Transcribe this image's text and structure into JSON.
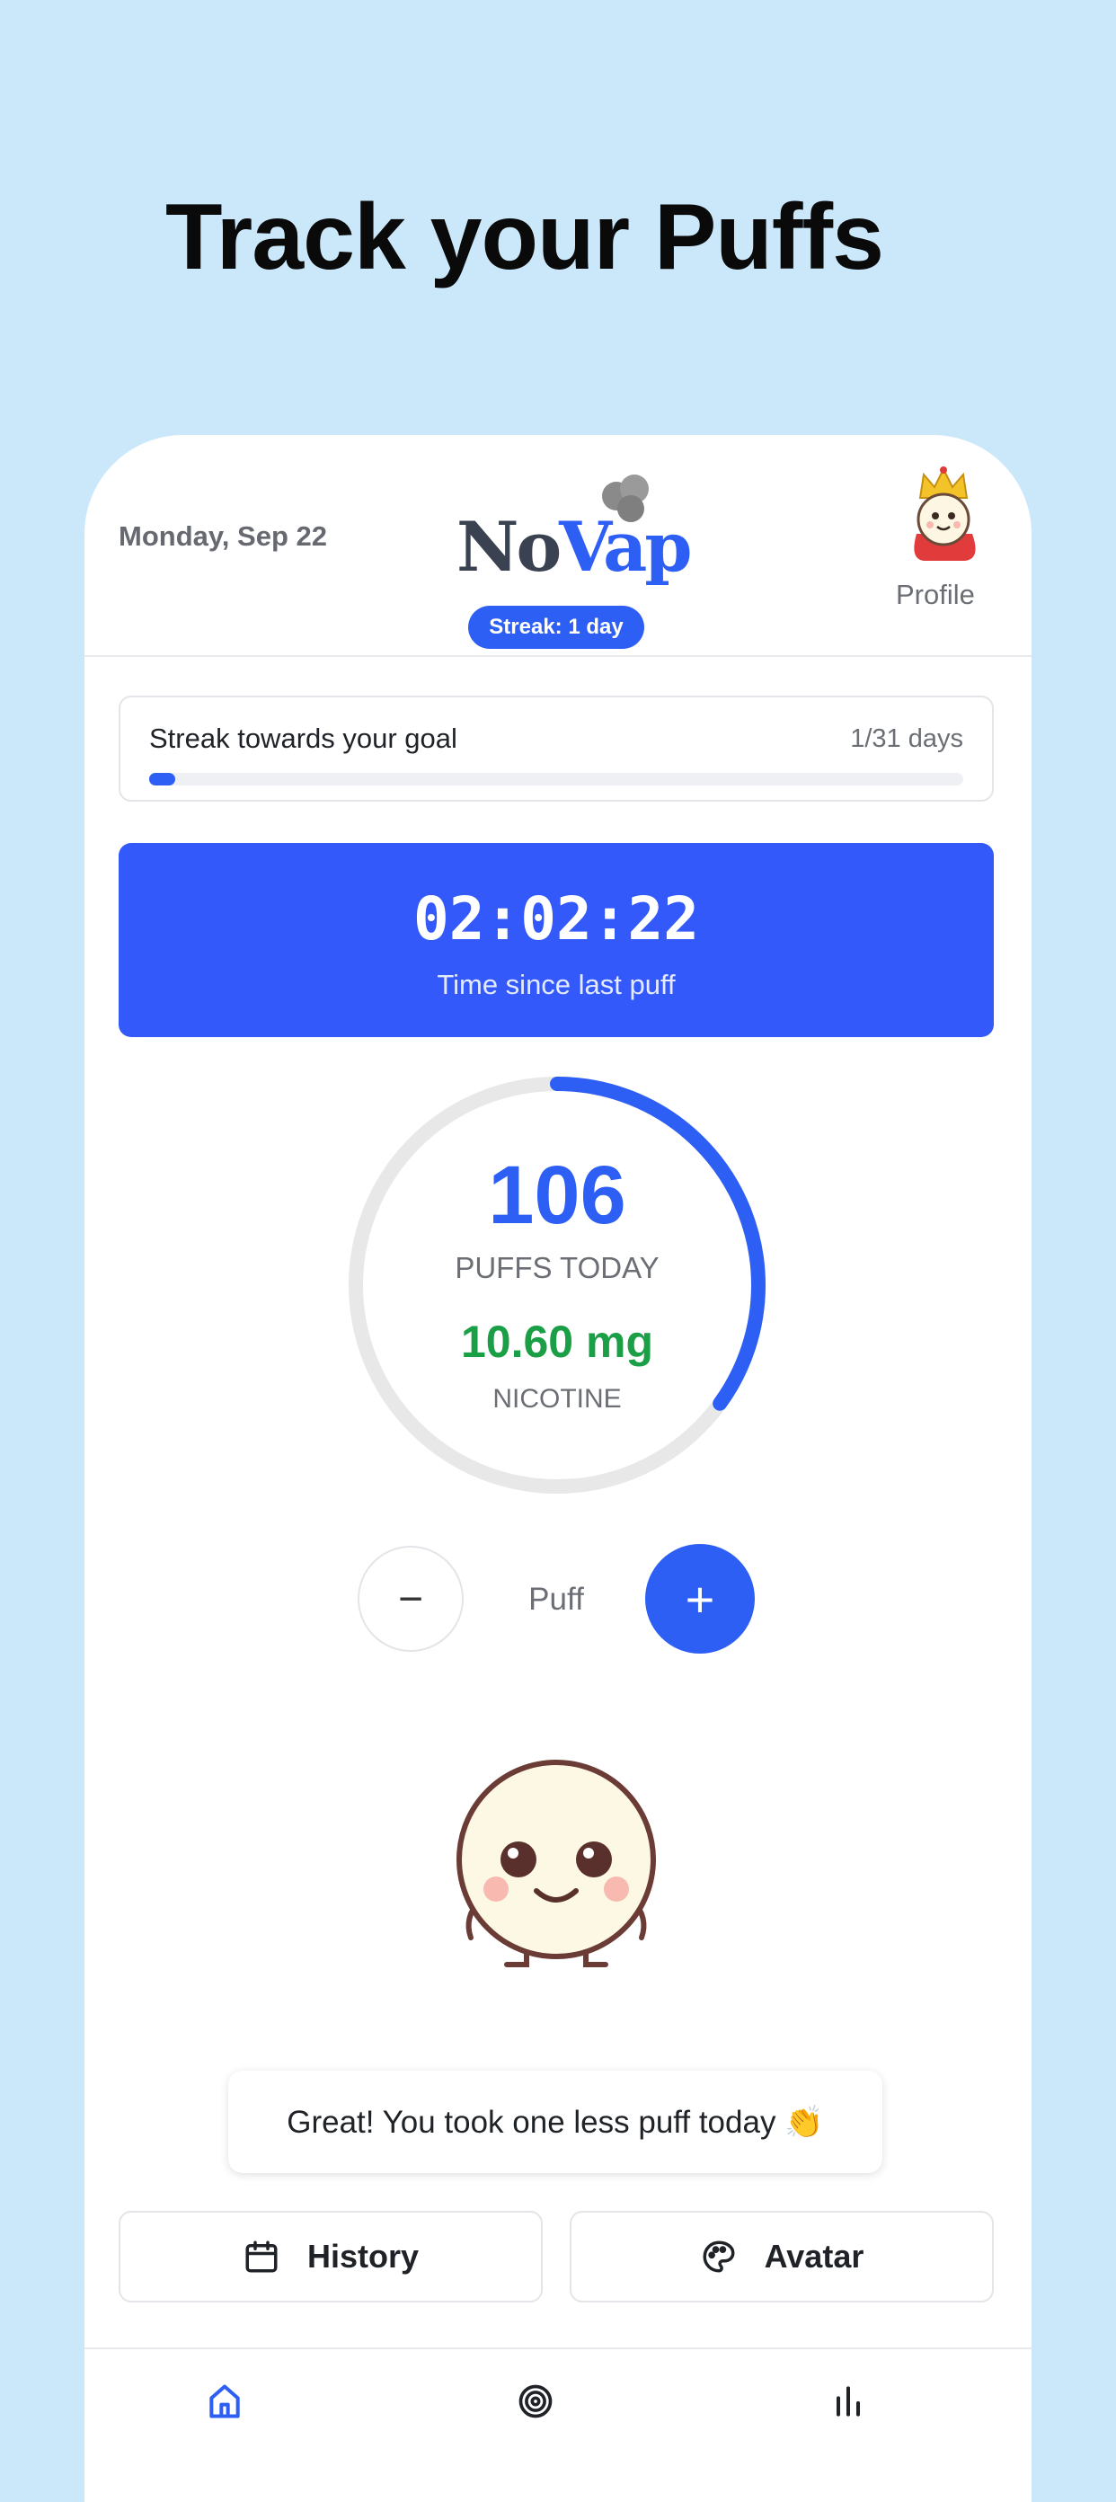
{
  "headline": "Track your Puffs",
  "header": {
    "date": "Monday, Sep 22",
    "logo_no": "No",
    "logo_vap": "Vap",
    "streak_badge": "Streak: 1 day",
    "profile_label": "Profile"
  },
  "goal": {
    "title": "Streak towards your goal",
    "days": "1/31 days",
    "progress_fraction": 0.032
  },
  "timer": {
    "value": "02:02:22",
    "label": "Time since last puff"
  },
  "stats": {
    "puffs_count": "106",
    "puffs_label": "PUFFS TODAY",
    "nicotine_value": "10.60 mg",
    "nicotine_label": "NICOTINE",
    "ring_fraction": 0.35
  },
  "controls": {
    "minus": "−",
    "puff_label": "Puff",
    "plus": "+"
  },
  "message": "Great! You took one less puff today 👏",
  "actions": {
    "history": "History",
    "avatar": "Avatar"
  },
  "icons": {
    "history": "calendar-icon",
    "avatar": "palette-icon",
    "tab_home": "home-icon",
    "tab_goals": "target-icon",
    "tab_stats": "bar-chart-icon"
  },
  "colors": {
    "accent": "#2e5ff5",
    "success": "#1a9f47",
    "background": "#cbe8fb"
  }
}
